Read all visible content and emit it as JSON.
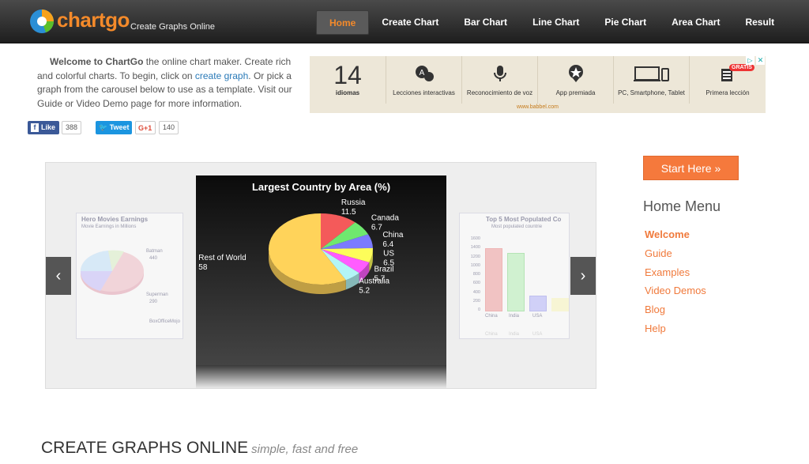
{
  "brand": {
    "name": "chartgo",
    "tagline": "Create Graphs Online"
  },
  "nav": [
    "Home",
    "Create Chart",
    "Bar Chart",
    "Line Chart",
    "Pie Chart",
    "Area Chart",
    "Result"
  ],
  "intro": {
    "bold": "Welcome to ChartGo",
    "text1": " the online chart maker. Create rich and colorful charts. To begin, click on ",
    "link": "create graph",
    "text2": ". Or pick a graph from the carousel below to use as a template. Visit our Guide or Video Demo page for more information."
  },
  "social": {
    "like": "Like",
    "like_count": "388",
    "tweet": "Tweet",
    "gplus": "G+1",
    "gplus_count": "140"
  },
  "ad": {
    "big_number": "14",
    "big_label": "idiomas",
    "items": [
      "Lecciones interactivas",
      "Reconocimiento de voz",
      "App premiada",
      "PC, Smartphone, Tablet",
      "Primera lección"
    ],
    "url": "www.babbel.com",
    "badge": "GRATIS"
  },
  "carousel": {
    "left_title": "Hero Movies Earnings",
    "left_sub": "Movie Earnings in Millions",
    "left_labels": [
      "Batman",
      "440",
      "Superman",
      "290",
      "BoxOfficeMojo"
    ],
    "right_title": "Top 5 Most Populated Co",
    "right_sub": "Most populated countrie",
    "right_ticks": [
      "1600",
      "1400",
      "1200",
      "1000",
      "800",
      "600",
      "400",
      "200",
      "0"
    ],
    "right_cats": [
      "China",
      "India",
      "USA"
    ],
    "right_reflect": [
      "China",
      "India",
      "USA"
    ]
  },
  "chart_data": {
    "type": "pie",
    "title": "Largest Country by Area (%)",
    "categories": [
      "Russia",
      "Canada",
      "China",
      "US",
      "Brazil",
      "Australia",
      "Rest of World"
    ],
    "values": [
      11.5,
      6.7,
      6.4,
      6.5,
      5.7,
      5.2,
      58
    ],
    "labels": [
      "11.5",
      "6.7",
      "6.4",
      "6.5",
      "5.7",
      "5.2",
      "58"
    ],
    "colors": [
      "#f45a5a",
      "#6fe86f",
      "#7b7bff",
      "#fdfd5a",
      "#ff5cff",
      "#b3f5f5",
      "#ffd35a"
    ]
  },
  "sidebar": {
    "start_button": "Start Here »",
    "menu_title": "Home Menu",
    "items": [
      "Welcome",
      "Guide",
      "Examples",
      "Video Demos",
      "Blog",
      "Help"
    ]
  },
  "footer": {
    "title": "CREATE GRAPHS ONLINE",
    "subtitle": "simple, fast and free"
  }
}
